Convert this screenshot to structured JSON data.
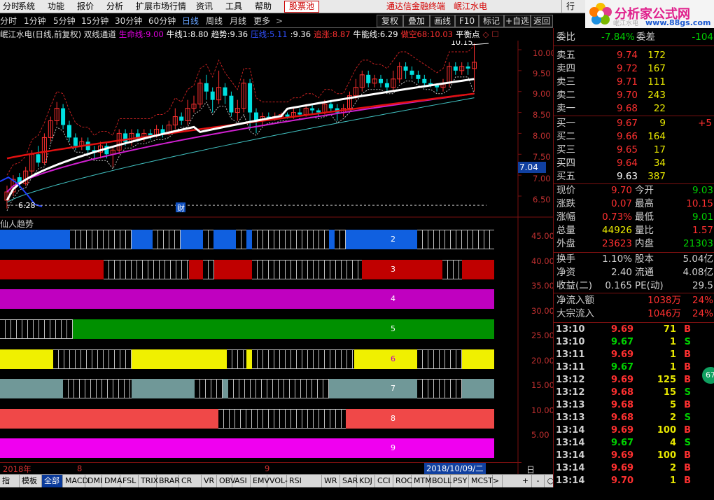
{
  "menu": {
    "items": [
      "分时",
      "系统",
      "功能",
      "报价",
      "分析",
      "扩展市场行情",
      "资讯",
      "工具",
      "帮助"
    ],
    "stockpool": "股票池",
    "terminal": "通达信金融终端",
    "stock": "岷江水电",
    "right_item": "行",
    "brand": "分析家公式网",
    "brand_url": "www.88gs.com",
    "brand_sub": "岷江水电"
  },
  "periods": {
    "items": [
      "分时",
      "1分钟",
      "5分钟",
      "15分钟",
      "30分钟",
      "60分钟",
      "日线",
      "周线",
      "月线",
      "更多"
    ],
    "selected": "日线",
    "more_arrow": ">",
    "buttons": [
      "复权",
      "叠加",
      "画线",
      "F10",
      "标记",
      "+自选",
      "返回"
    ]
  },
  "info": {
    "title": "岷江水电(日线,前复权) 双线通道",
    "items": [
      {
        "label": "生命线:",
        "value": "9.00",
        "color": "#e000e0"
      },
      {
        "label": "牛线1:",
        "value": "8.80",
        "color": "#ffffff"
      },
      {
        "label": "趋势:",
        "value": "9.36",
        "color": "#ffffff"
      },
      {
        "label": "压线:",
        "value": "5.11",
        "color": "#3050ff"
      },
      {
        "label": ":",
        "value": "9.36",
        "color": "#ffffff"
      },
      {
        "label": "追涨:",
        "value": "8.87",
        "color": "#ff3030"
      },
      {
        "label": "牛能线:",
        "value": "6.29",
        "color": "#ffffff"
      },
      {
        "label": "做空68:",
        "value": "10.03",
        "color": "#ff3030"
      },
      {
        "label": "平衡点",
        "value": "",
        "color": "#ffffff"
      }
    ],
    "icons": [
      "diamond-icon",
      "square-icon"
    ]
  },
  "price_axis": [
    "10.00",
    "9.50",
    "9.00",
    "8.50",
    "8.00",
    "7.50",
    "7.00",
    "6.50"
  ],
  "price_marker": "7.04",
  "chart_labels": {
    "high": "10.15",
    "low": "6.28",
    "cai": "财"
  },
  "indicator_title": "仙人趋势",
  "indicator_axis": [
    "45.00",
    "40.00",
    "35.00",
    "30.00",
    "25.00",
    "20.00",
    "15.00",
    "10.00",
    "5.00"
  ],
  "strips": [
    {
      "label": "2",
      "color": "#1060e0"
    },
    {
      "label": "3",
      "color": "#c00000"
    },
    {
      "label": "4",
      "color": "#c000c0"
    },
    {
      "label": "5",
      "color": "#009000"
    },
    {
      "label": "6",
      "color": "#f0f000"
    },
    {
      "label": "7",
      "color": "#709898"
    },
    {
      "label": "8",
      "color": "#f04848"
    },
    {
      "label": "9",
      "color": "#f000f0"
    }
  ],
  "datebar": {
    "year": "2018年",
    "m1": "8",
    "m2": "9",
    "cursor": "2018/10/09/二",
    "period": "日线"
  },
  "bottom": [
    "指标",
    "模板",
    "全部",
    "MACD",
    "DMI",
    "DMA",
    "FSL",
    "TRIX",
    "BRAR",
    "CR",
    "VR",
    "OBV",
    "ASI",
    "EMV",
    "VOL-TDX",
    "RSI",
    "WR",
    "SAR",
    "KDJ",
    "CCI",
    "ROC",
    "MTM",
    "BOLL",
    "PSY",
    "MCST"
  ],
  "bottom_selected": "全部",
  "bottom_right": [
    ">",
    "+",
    "-",
    "○"
  ],
  "top_row": {
    "a": "委比",
    "b": "-7.84%",
    "c": "委差",
    "d": "-104"
  },
  "asks": [
    {
      "label": "卖五",
      "price": "9.74",
      "vol": "172"
    },
    {
      "label": "卖四",
      "price": "9.72",
      "vol": "167"
    },
    {
      "label": "卖三",
      "price": "9.71",
      "vol": "111"
    },
    {
      "label": "卖二",
      "price": "9.70",
      "vol": "243"
    },
    {
      "label": "卖一",
      "price": "9.68",
      "vol": "22"
    }
  ],
  "bids": [
    {
      "label": "买一",
      "price": "9.67",
      "vol": "9",
      "extra": "+5"
    },
    {
      "label": "买二",
      "price": "9.66",
      "vol": "164",
      "extra": ""
    },
    {
      "label": "买三",
      "price": "9.65",
      "vol": "17",
      "extra": ""
    },
    {
      "label": "买四",
      "price": "9.64",
      "vol": "34",
      "extra": ""
    },
    {
      "label": "买五",
      "price": "9.63",
      "vol": "387",
      "extra": ""
    }
  ],
  "quote": [
    {
      "l1": "现价",
      "v1": "9.70",
      "c1": "#ff3030",
      "l2": "今开",
      "v2": "9.03",
      "c2": "#00d000"
    },
    {
      "l1": "涨跌",
      "v1": "0.07",
      "c1": "#ff3030",
      "l2": "最高",
      "v2": "10.15",
      "c2": "#ff3030"
    },
    {
      "l1": "涨幅",
      "v1": "0.73%",
      "c1": "#ff3030",
      "l2": "最低",
      "v2": "9.01",
      "c2": "#00d000"
    },
    {
      "l1": "总量",
      "v1": "44926",
      "c1": "#e8e800",
      "l2": "量比",
      "v2": "1.57",
      "c2": "#ff3030"
    },
    {
      "l1": "外盘",
      "v1": "23623",
      "c1": "#ff3030",
      "l2": "内盘",
      "v2": "21303",
      "c2": "#00d000"
    }
  ],
  "quote2": [
    {
      "l1": "换手",
      "v1": "1.10%",
      "c1": "#d0d0d0",
      "l2": "股本",
      "v2": "5.04亿",
      "c2": "#d0d0d0"
    },
    {
      "l1": "净资",
      "v1": "2.40",
      "c1": "#d0d0d0",
      "l2": "流通",
      "v2": "4.08亿",
      "c2": "#d0d0d0"
    },
    {
      "l1": "收益(二)",
      "v1": "0.165",
      "c1": "#d0d0d0",
      "l2": "PE(动)",
      "v2": "29.5",
      "c2": "#d0d0d0"
    }
  ],
  "flows": [
    {
      "label": "净流入额",
      "value": "1038万",
      "pct": "24%"
    },
    {
      "label": "大宗流入",
      "value": "1046万",
      "pct": "24%"
    }
  ],
  "trades": [
    {
      "t": "13:10",
      "p": "9.69",
      "v": "71",
      "s": "B"
    },
    {
      "t": "13:10",
      "p": "9.67",
      "v": "1",
      "s": "S"
    },
    {
      "t": "13:11",
      "p": "9.69",
      "v": "1",
      "s": "B"
    },
    {
      "t": "13:11",
      "p": "9.67",
      "v": "1",
      "s": "B"
    },
    {
      "t": "13:12",
      "p": "9.69",
      "v": "125",
      "s": "B"
    },
    {
      "t": "13:12",
      "p": "9.68",
      "v": "15",
      "s": "S"
    },
    {
      "t": "13:13",
      "p": "9.68",
      "v": "5",
      "s": "B"
    },
    {
      "t": "13:13",
      "p": "9.68",
      "v": "2",
      "s": "S"
    },
    {
      "t": "13:14",
      "p": "9.69",
      "v": "100",
      "s": "B"
    },
    {
      "t": "13:14",
      "p": "9.67",
      "v": "4",
      "s": "S"
    },
    {
      "t": "13:14",
      "p": "9.69",
      "v": "100",
      "s": "B"
    },
    {
      "t": "13:14",
      "p": "9.69",
      "v": "2",
      "s": "B"
    },
    {
      "t": "13:14",
      "p": "9.70",
      "v": "1",
      "s": "B"
    }
  ],
  "badge": "67",
  "colors": {
    "up": "#ff3030",
    "down": "#00d000",
    "axis": "#7a1010"
  }
}
